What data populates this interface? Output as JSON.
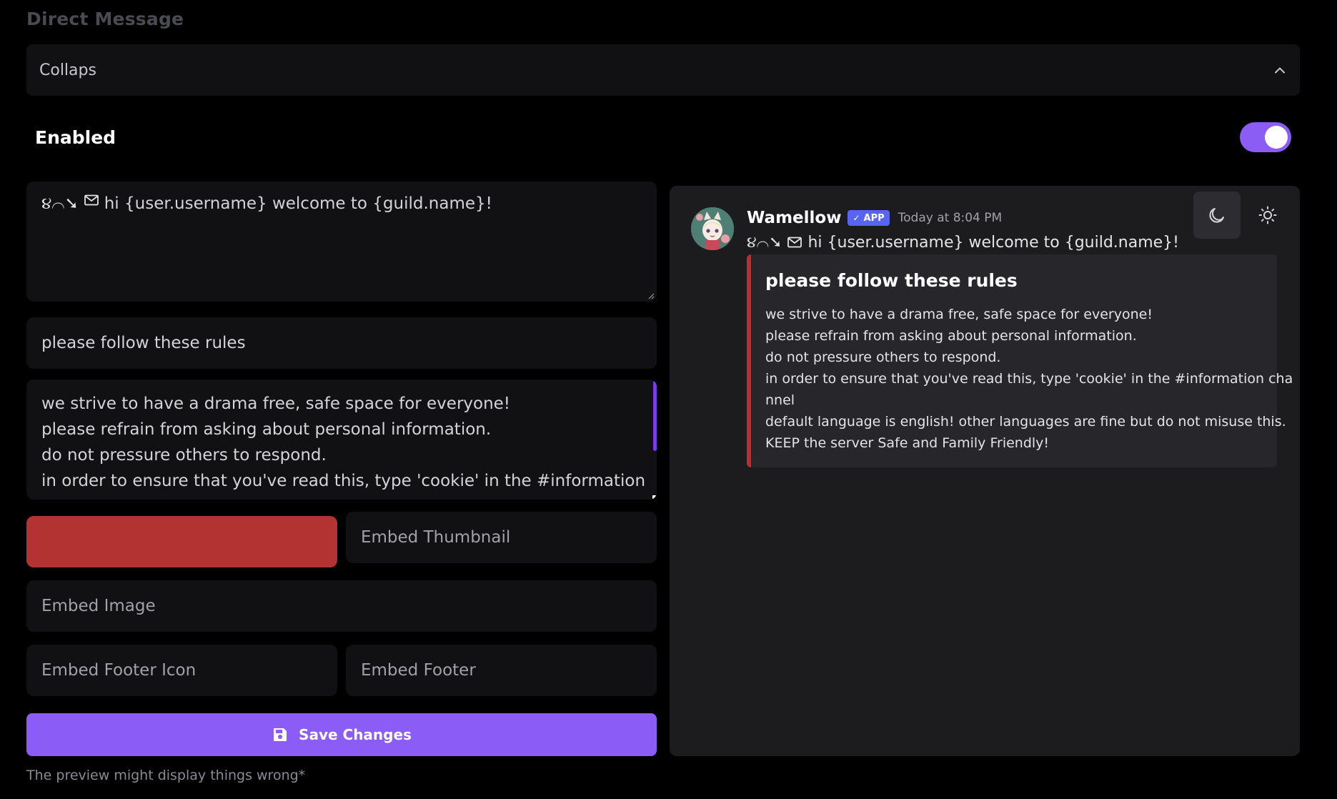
{
  "section": {
    "title": "Direct Message"
  },
  "collapse": {
    "label": "Collaps"
  },
  "enabled": {
    "label": "Enabled",
    "value": true
  },
  "editor": {
    "content_prefix": "૪⌒➘",
    "content_text": "hi {user.username} welcome to {guild.name}!",
    "embed_title": "please follow these rules",
    "description_lines": [
      "we strive to have a drama free, safe space for everyone!",
      "please refrain from asking about personal information.",
      "do not pressure others to respond.",
      "in order to ensure that you've read this, type 'cookie' in the #information"
    ],
    "embed_color": "#b33232",
    "thumbnail_placeholder": "Embed Thumbnail",
    "image_placeholder": "Embed Image",
    "footer_icon_placeholder": "Embed Footer Icon",
    "footer_placeholder": "Embed Footer",
    "save_label": "Save Changes",
    "footnote": "The preview might display things wrong*"
  },
  "preview": {
    "username": "Wamellow",
    "badge": "APP",
    "timestamp": "Today at 8:04 PM",
    "content_prefix": "૪⌒➘",
    "content_text": "hi {user.username} welcome to {guild.name}!",
    "embed": {
      "title": "please follow these rules",
      "lines": [
        "we strive to have a drama free, safe space for everyone!",
        "please refrain from asking about personal information.",
        "do not pressure others to respond.",
        "in order to ensure that you've read this, type 'cookie' in the #information cha",
        "nnel",
        "default language is english! other languages are fine but do not misuse this.",
        "KEEP the server Safe and Family Friendly!"
      ]
    }
  },
  "icons": {
    "collapse": "chevron-up-icon",
    "save": "floppy-disk-icon",
    "dark": "moon-icon",
    "light": "sun-icon",
    "mail": "envelope-icon",
    "badge": "check-icon"
  },
  "colors": {
    "accent": "#8b5cf6",
    "embed_color": "#b33232",
    "badge": "#5865f2"
  }
}
